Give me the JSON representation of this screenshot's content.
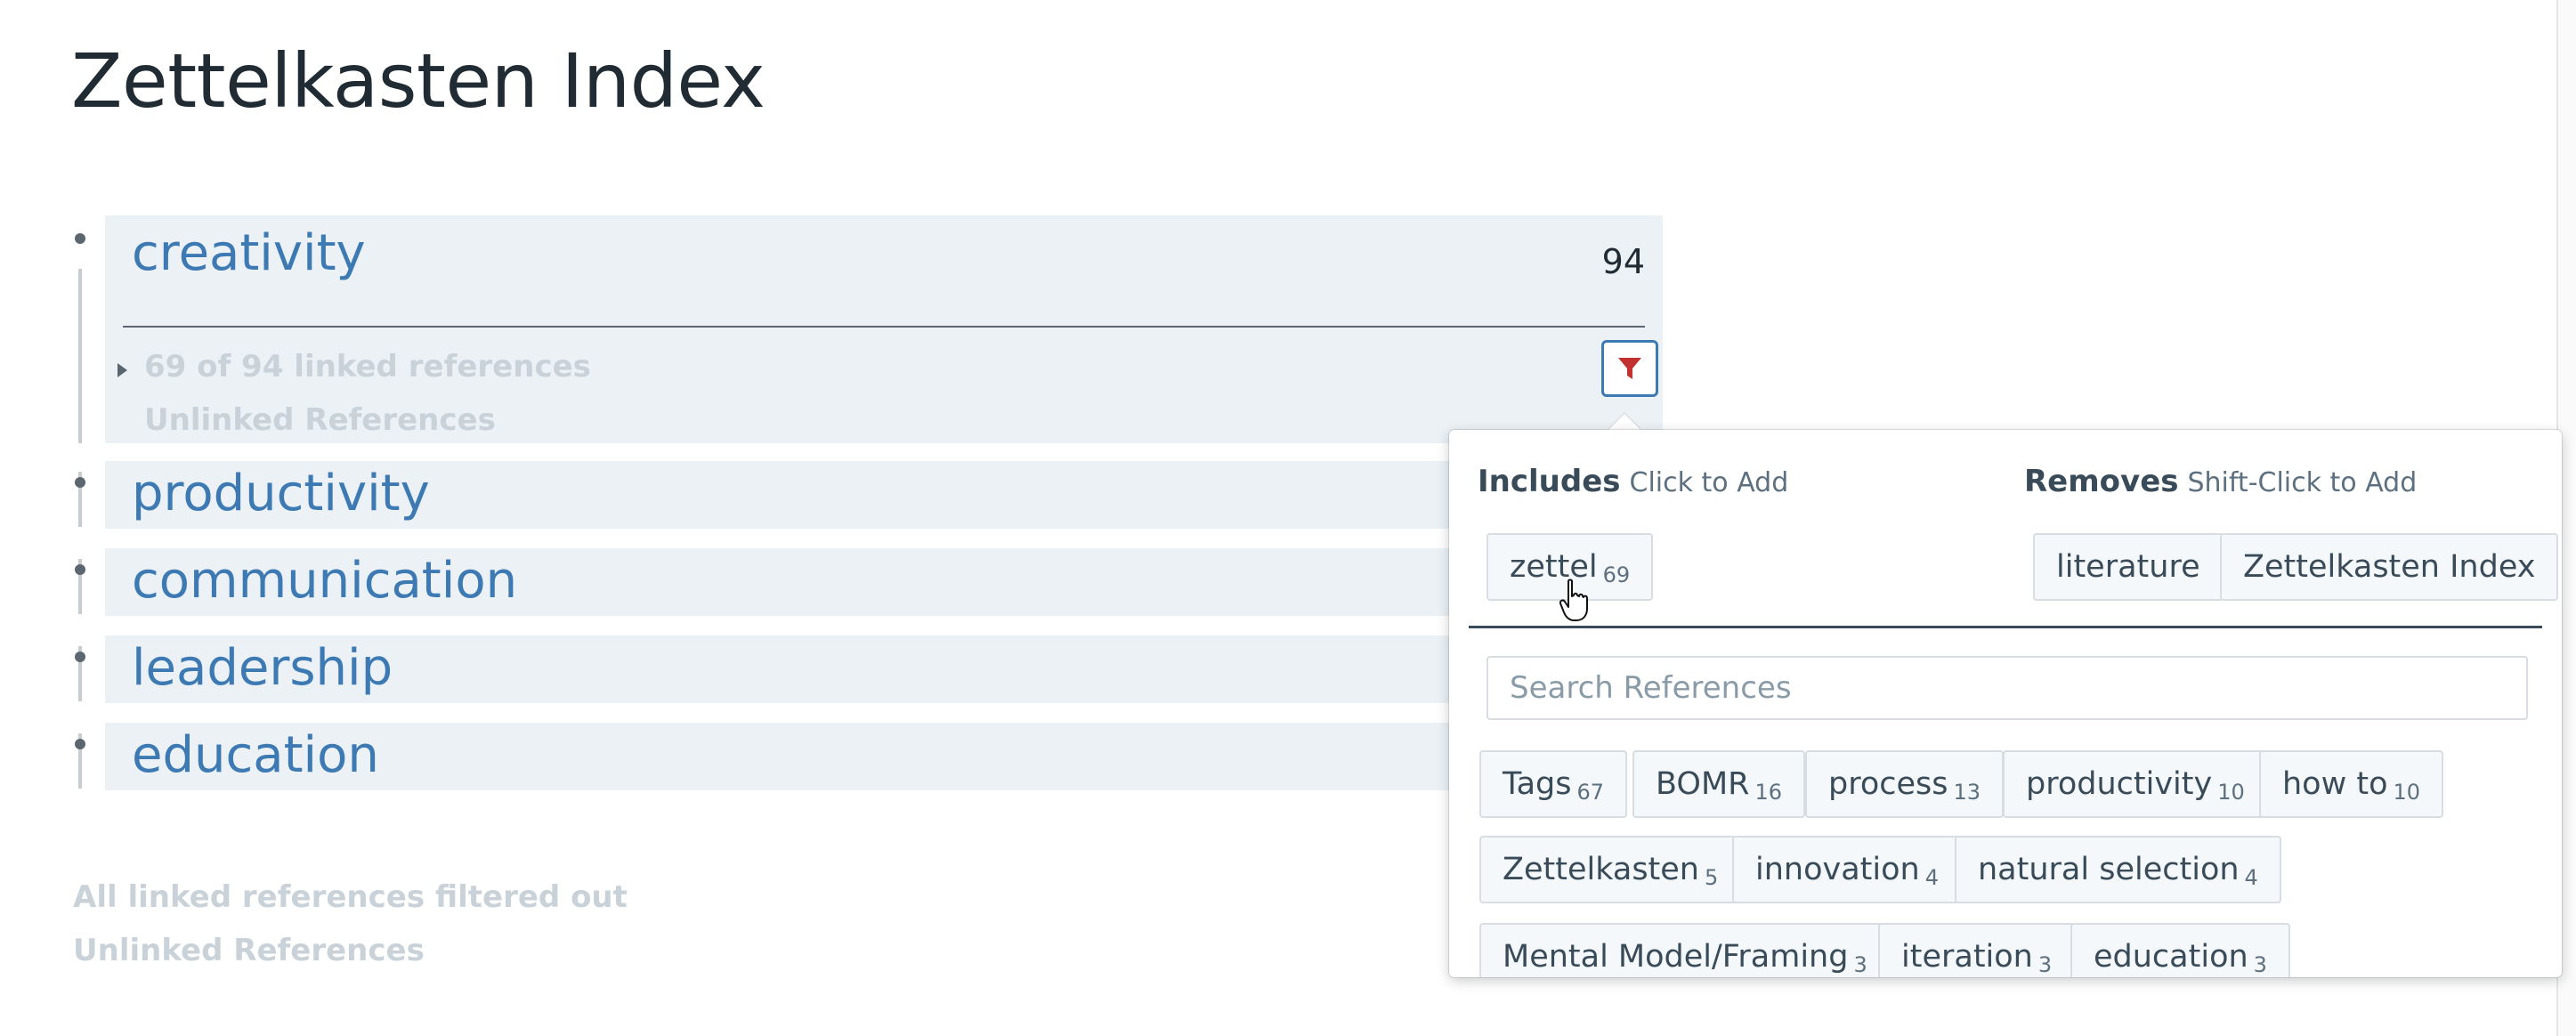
{
  "page": {
    "title": "Zettelkasten Index"
  },
  "outline": {
    "expanded": {
      "label": "creativity",
      "count": "94",
      "linked_summary": "69 of 94 linked references",
      "unlinked_label": "Unlinked References"
    },
    "items": [
      "productivity",
      "communication",
      "leadership",
      "education"
    ]
  },
  "footer": {
    "filtered_text": "All linked references filtered out",
    "unlinked_label": "Unlinked References"
  },
  "filter_popover": {
    "includes_title": "Includes",
    "includes_hint": "Click to Add",
    "removes_title": "Removes",
    "removes_hint": "Shift-Click to Add",
    "include_chips": [
      {
        "label": "zettel",
        "count": "69"
      }
    ],
    "remove_chips": [
      {
        "label": "literature"
      },
      {
        "label": "Zettelkasten Index"
      }
    ],
    "search_placeholder": "Search References",
    "available_chips": [
      {
        "label": "Tags",
        "count": "67"
      },
      {
        "label": "BOMR",
        "count": "16"
      },
      {
        "label": "process",
        "count": "13"
      },
      {
        "label": "productivity",
        "count": "10"
      },
      {
        "label": "how to",
        "count": "10"
      },
      {
        "label": "Zettelkasten",
        "count": "5"
      },
      {
        "label": "innovation",
        "count": "4"
      },
      {
        "label": "natural selection",
        "count": "4"
      },
      {
        "label": "Mental Model/Framing",
        "count": "3"
      },
      {
        "label": "iteration",
        "count": "3"
      },
      {
        "label": "education",
        "count": "3"
      }
    ]
  },
  "icons": {
    "filter": "funnel-icon",
    "pointer": "hand-pointer-icon"
  },
  "colors": {
    "link": "#3d7ab4",
    "filter_active": "#c23030",
    "block_bg": "#ebf1f5"
  }
}
